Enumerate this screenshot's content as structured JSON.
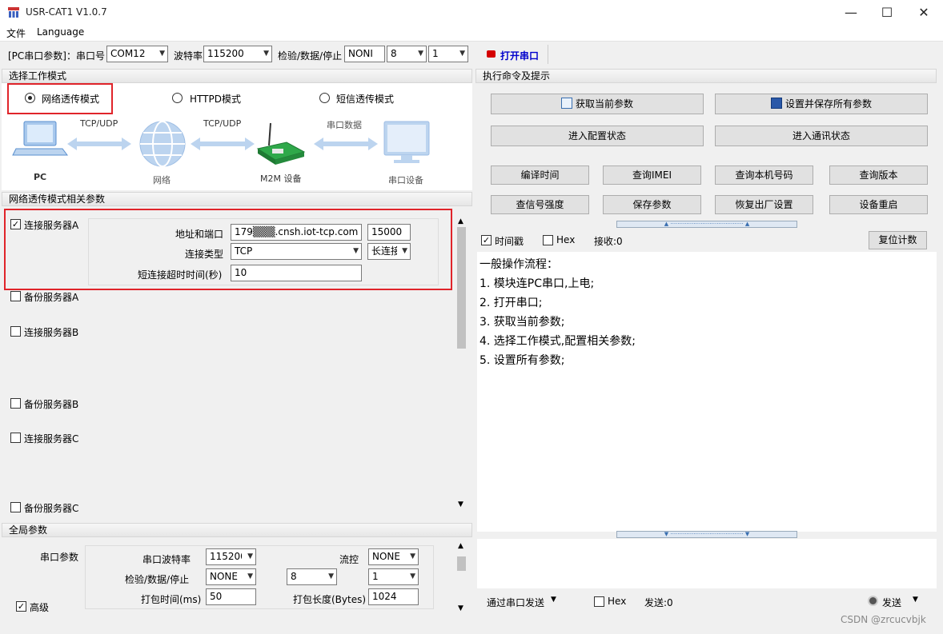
{
  "window": {
    "title": "USR-CAT1 V1.0.7",
    "minimize": "—",
    "maximize": "☐",
    "close": "✕"
  },
  "menu": {
    "file": "文件",
    "language": "Language"
  },
  "toolbar": {
    "pc_params_label": "[PC串口参数]：串口号",
    "port": "COM12",
    "baud_label": "波特率",
    "baud": "115200",
    "parity_label": "检验/数据/停止",
    "parity": "NONI",
    "databits": "8",
    "stopbits": "1",
    "open_port": "打开串口",
    "accent_red": "#d40000",
    "accent_blue": "#0000cc"
  },
  "mode": {
    "header": "选择工作模式",
    "options": [
      "网络透传模式",
      "HTTPD模式",
      "短信透传模式"
    ],
    "selected": "网络透传模式",
    "diagram": {
      "pc": "PC",
      "proto1": "TCP/UDP",
      "net": "网络",
      "proto2": "TCP/UDP",
      "m2m": "M2M 设备",
      "serial_data": "串口数据",
      "serial_dev": "串口设备"
    }
  },
  "net_params": {
    "header": "网络透传模式相关参数",
    "server_a": {
      "label": "连接服务器A",
      "checked": true,
      "addr_label": "地址和端口",
      "addr": "179▒▒▒.cnsh.iot-tcp.com",
      "port": "15000",
      "type_label": "连接类型",
      "type": "TCP",
      "conn": "长连接",
      "timeout_label": "短连接超时时间(秒)",
      "timeout": "10"
    },
    "others": [
      "备份服务器A",
      "连接服务器B",
      "备份服务器B",
      "连接服务器C",
      "备份服务器C"
    ]
  },
  "global": {
    "header": "全局参数",
    "serial_label": "串口参数",
    "baud_label": "串口波特率",
    "baud": "115200",
    "flow_label": "流控",
    "flow": "NONE",
    "parity_label": "检验/数据/停止",
    "parity": "NONE",
    "databits": "8",
    "stopbits": "1",
    "pack_time_label": "打包时间(ms)",
    "pack_time": "50",
    "pack_len_label": "打包长度(Bytes)",
    "pack_len": "1024",
    "advanced": "高级"
  },
  "exec": {
    "header": "执行命令及提示",
    "get_params": "获取当前参数",
    "save_all": "设置并保存所有参数",
    "enter_config": "进入配置状态",
    "enter_comm": "进入通讯状态",
    "buttons_row1": [
      "编译时间",
      "查询IMEI",
      "查询本机号码",
      "查询版本"
    ],
    "buttons_row2": [
      "查信号强度",
      "保存参数",
      "恢复出厂设置",
      "设备重启"
    ],
    "timestamp": "时间戳",
    "hex": "Hex",
    "recv": "接收:0",
    "reset_count": "复位计数",
    "log": [
      "一般操作流程：",
      "1. 模块连PC串口,上电;",
      "2. 打开串口;",
      "3. 获取当前参数;",
      "4. 选择工作模式,配置相关参数;",
      "5. 设置所有参数;"
    ],
    "send_via": "通过串口发送",
    "send_hex": "Hex",
    "sent": "发送:0",
    "send": "发送"
  },
  "watermark": "CSDN @zrcucvbjk"
}
